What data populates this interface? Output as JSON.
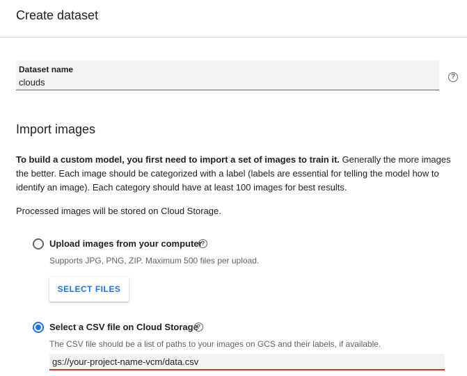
{
  "header": {
    "title": "Create dataset"
  },
  "dataset": {
    "label": "Dataset name",
    "value": "clouds",
    "help_glyph": "?"
  },
  "import": {
    "title": "Import images",
    "desc_bold": "To build a custom model, you first need to import a set of images to train it.",
    "desc_rest": " Generally the more images the better. Each image should be categorized with a label (labels are essential for telling the model how to identify an image). Each category should have at least 100 images for best results.",
    "storage_note": "Processed images will be stored on Cloud Storage."
  },
  "options": {
    "upload": {
      "label": "Upload images from your computer",
      "hint": "Supports JPG, PNG, ZIP. Maximum 500 files per upload.",
      "button": "SELECT FILES",
      "help_glyph": "?",
      "selected": false
    },
    "csv": {
      "label": "Select a CSV file on Cloud Storage",
      "hint": "The CSV file should be a list of paths to your images on GCS and their labels, if available.",
      "value": "gs://your-project-name-vcm/data.csv",
      "help_glyph": "?",
      "selected": true
    }
  },
  "colors": {
    "accent": "#1a73e8",
    "error_underline": "#d93025",
    "field_bg": "#f1f3f4",
    "secondary_text": "#5f6368"
  }
}
